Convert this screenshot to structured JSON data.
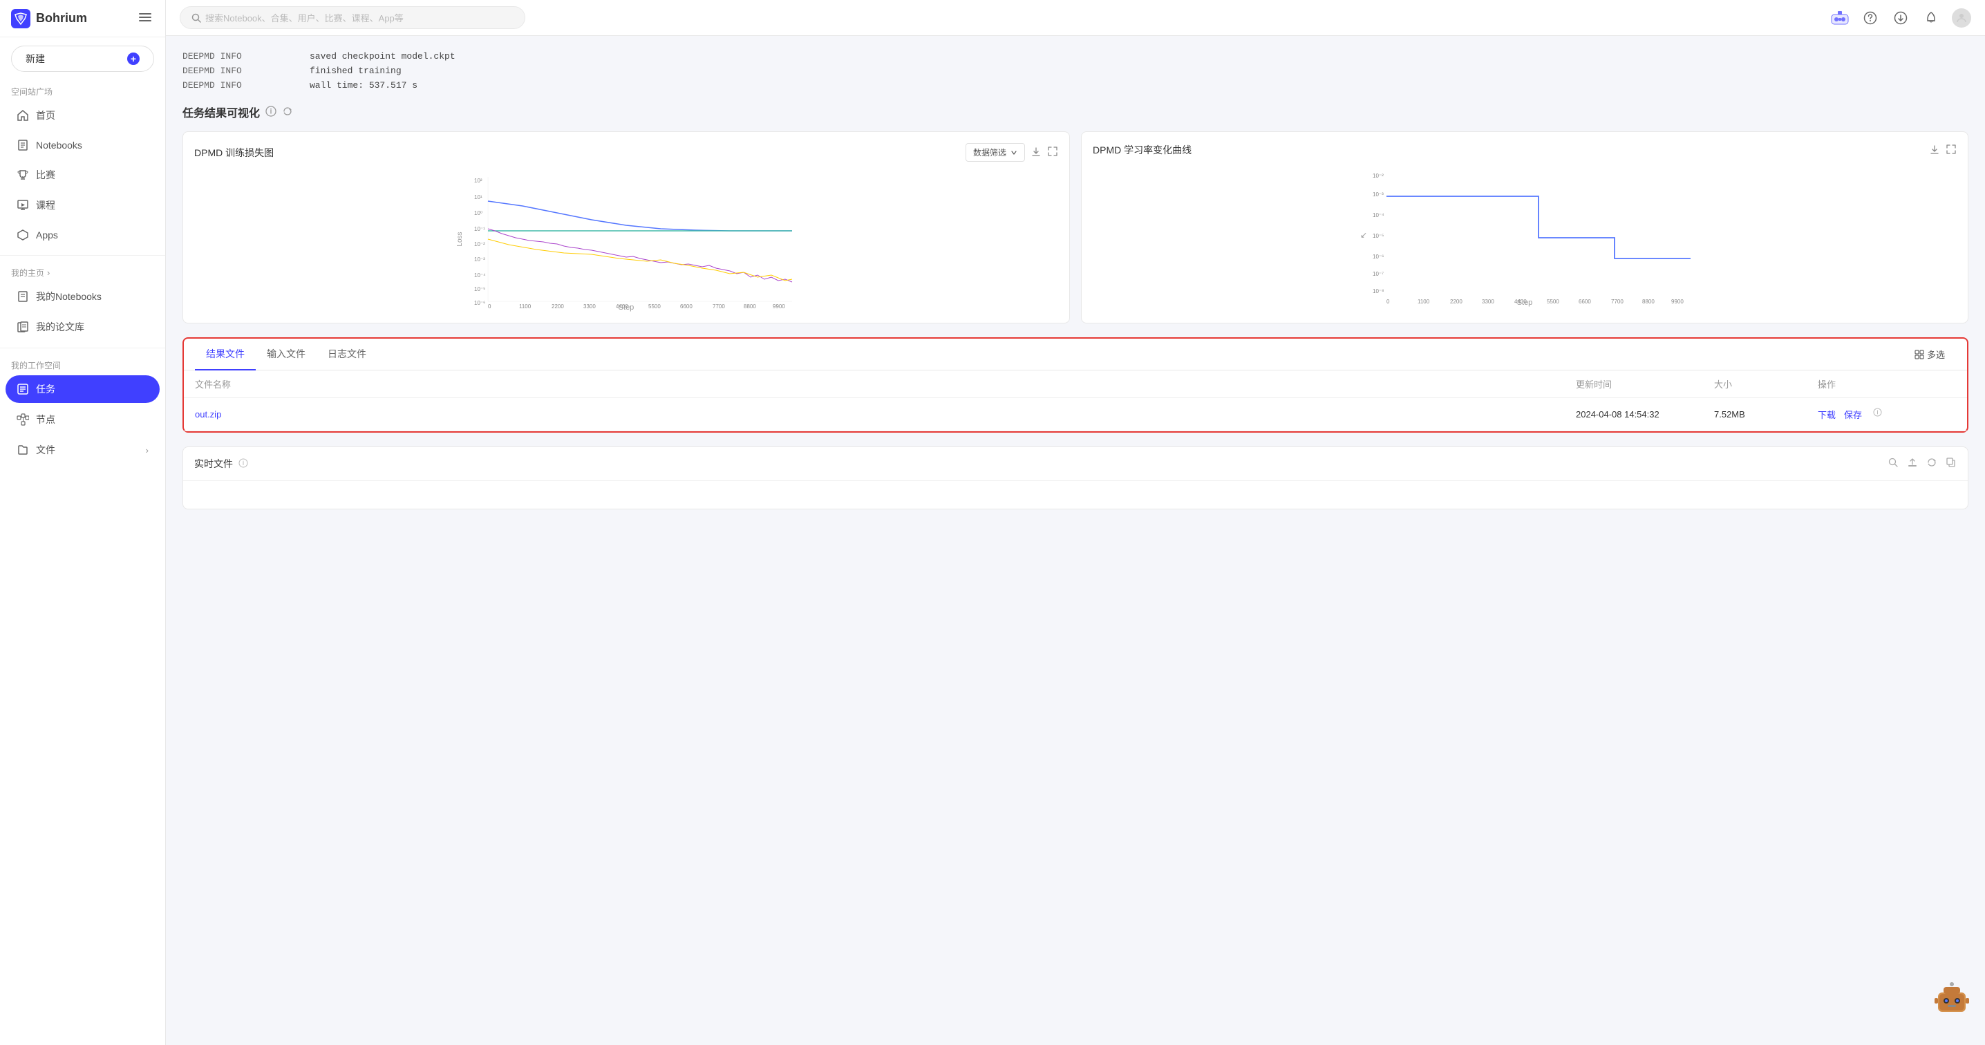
{
  "app": {
    "name": "Bohrium"
  },
  "topbar": {
    "search_placeholder": "搜索Notebook、合集、用户、比赛、课程、App等"
  },
  "sidebar": {
    "new_button": "新建",
    "section_public": "空间站广场",
    "nav_items": [
      {
        "id": "home",
        "label": "首页"
      },
      {
        "id": "notebooks",
        "label": "Notebooks"
      },
      {
        "id": "competition",
        "label": "比赛"
      },
      {
        "id": "course",
        "label": "课程"
      },
      {
        "id": "apps",
        "label": "Apps"
      }
    ],
    "section_my": "我的主页",
    "my_nav_arrow": "›",
    "my_items": [
      {
        "id": "my-notebooks",
        "label": "我的Notebooks"
      },
      {
        "id": "my-papers",
        "label": "我的论文库"
      }
    ],
    "section_workspace": "我的工作空间",
    "workspace_items": [
      {
        "id": "task",
        "label": "任务",
        "active": true
      },
      {
        "id": "node",
        "label": "节点"
      },
      {
        "id": "files",
        "label": "文件",
        "has_arrow": true
      }
    ]
  },
  "terminal": {
    "lines": [
      {
        "source": "DEEPMD INFO",
        "level": "",
        "message": "saved checkpoint model.ckpt"
      },
      {
        "source": "DEEPMD INFO",
        "level": "",
        "message": "finished training"
      },
      {
        "source": "DEEPMD INFO",
        "level": "",
        "message": "wall time: 537.517 s"
      }
    ]
  },
  "visualization": {
    "section_title": "任务结果可视化",
    "charts": [
      {
        "id": "loss-chart",
        "title": "DPMD 训练损失图",
        "filter_label": "数据筛选",
        "x_label": "Step",
        "y_label": "Loss",
        "x_ticks": [
          "0",
          "1100",
          "2200",
          "3300",
          "4400",
          "5500",
          "6600",
          "7700",
          "8800",
          "9900"
        ],
        "y_ticks": [
          "10⁻⁶",
          "10⁻⁵",
          "10⁻⁴",
          "10⁻³",
          "10⁻²",
          "10⁻¹",
          "10⁰",
          "10¹",
          "10²"
        ]
      },
      {
        "id": "lr-chart",
        "title": "DPMD 学习率变化曲线",
        "x_label": "Step",
        "x_ticks": [
          "0",
          "1100",
          "2200",
          "3300",
          "4400",
          "5500",
          "6600",
          "7700",
          "8800",
          "9900"
        ],
        "y_ticks": [
          "10⁻⁸",
          "10⁻⁷",
          "10⁻⁶",
          "10⁻⁵",
          "10⁻⁴",
          "10⁻³",
          "10⁻²"
        ]
      }
    ]
  },
  "file_section": {
    "tabs": [
      "结果文件",
      "输入文件",
      "日志文件"
    ],
    "active_tab": "结果文件",
    "multi_select": "多选",
    "table_headers": [
      "文件名称",
      "更新时间",
      "大小",
      "操作"
    ],
    "files": [
      {
        "name": "out.zip",
        "updated": "2024-04-08 14:54:32",
        "size": "7.52MB",
        "ops": [
          "下载",
          "保存"
        ]
      }
    ]
  },
  "realtime_section": {
    "title": "实时文件"
  }
}
